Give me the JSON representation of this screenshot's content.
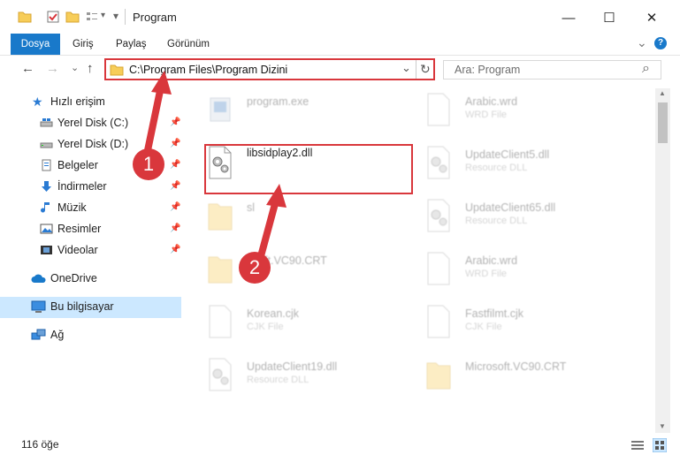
{
  "window": {
    "title": "Program",
    "minimize": "—",
    "maximize": "☐",
    "close": "✕"
  },
  "ribbon": {
    "tabs": [
      "Dosya",
      "Giriş",
      "Paylaş",
      "Görünüm"
    ],
    "expand": "⌄",
    "help": "?"
  },
  "nav": {
    "back": "←",
    "forward": "→",
    "recent": "⌄",
    "up": "↑",
    "address": "C:\\Program Files\\Program Dizini",
    "dropdown": "⌄",
    "refresh": "↻",
    "search_placeholder": "Ara: Program",
    "search_icon": "⌕"
  },
  "sidebar": {
    "quick_access": "Hızlı erişim",
    "items": [
      {
        "label": "Yerel Disk (C:)",
        "icon": "drive-icon"
      },
      {
        "label": "Yerel Disk (D:)",
        "icon": "drive-icon"
      },
      {
        "label": "Belgeler",
        "icon": "documents-icon"
      },
      {
        "label": "İndirmeler",
        "icon": "downloads-icon"
      },
      {
        "label": "Müzik",
        "icon": "music-icon"
      },
      {
        "label": "Resimler",
        "icon": "pictures-icon"
      },
      {
        "label": "Videolar",
        "icon": "videos-icon"
      }
    ],
    "onedrive": "OneDrive",
    "this_pc": "Bu bilgisayar",
    "network": "Ağ"
  },
  "files": {
    "left": [
      {
        "name": "program.exe",
        "type": ""
      },
      {
        "name": "libsidplay2.dll",
        "type": ""
      },
      {
        "name": "sl",
        "type": ""
      },
      {
        "name": "osoft.VC90.CRT",
        "type": ""
      },
      {
        "name": "Korean.cjk",
        "type": "CJK File"
      },
      {
        "name": "UpdateClient19.dll",
        "type": "Resource DLL"
      }
    ],
    "right": [
      {
        "name": "Arabic.wrd",
        "type": "WRD File"
      },
      {
        "name": "UpdateClient5.dll",
        "type": "Resource DLL"
      },
      {
        "name": "UpdateClient65.dll",
        "type": "Resource DLL"
      },
      {
        "name": "Arabic.wrd",
        "type": "WRD File"
      },
      {
        "name": "Fastfilmt.cjk",
        "type": "CJK File"
      },
      {
        "name": "Microsoft.VC90.CRT",
        "type": ""
      }
    ]
  },
  "status": {
    "count": "116 öğe"
  },
  "badges": {
    "one": "1",
    "two": "2"
  },
  "colors": {
    "accent": "#1979ca",
    "highlight": "#d9373c",
    "selected": "#cce8ff"
  }
}
